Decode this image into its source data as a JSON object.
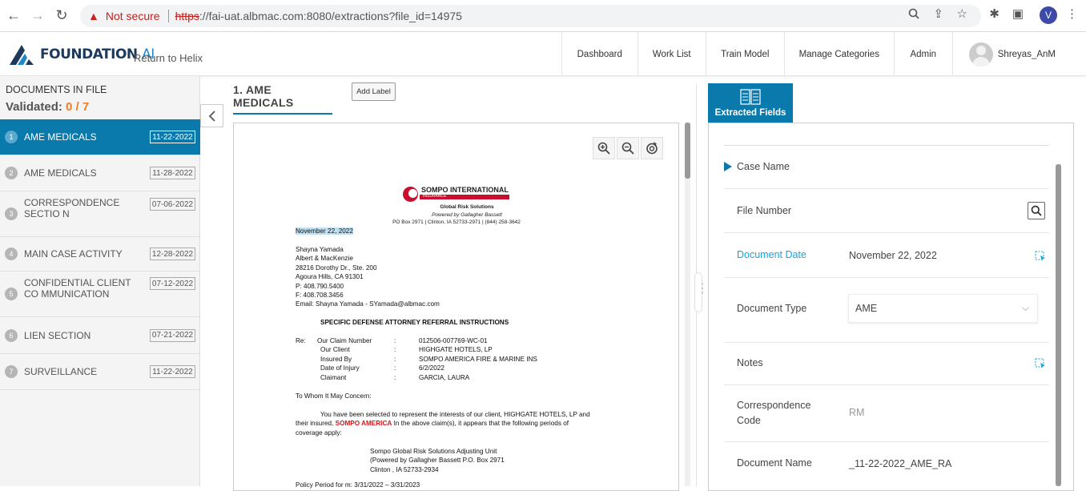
{
  "browser": {
    "not_secure": "Not secure",
    "url_scheme": "https",
    "url_rest": "://fai-uat.albmac.com:8080/extractions?file_id=14975",
    "profile_initial": "V"
  },
  "header": {
    "logo_main": "FOUNDATION",
    "logo_ai": "AI",
    "return_link": "Return to Helix",
    "nav": [
      "Dashboard",
      "Work List",
      "Train Model",
      "Manage Categories",
      "Admin"
    ],
    "user_name": "Shreyas_AnM"
  },
  "left": {
    "title": "DOCUMENTS IN FILE",
    "validated_label": "Validated:",
    "validated_count": "0 / 7",
    "documents": [
      {
        "num": "1",
        "name": "AME MEDICALS",
        "date": "11-22-2022"
      },
      {
        "num": "2",
        "name": "AME MEDICALS",
        "date": "11-28-2022"
      },
      {
        "num": "3",
        "name": "CORRESPONDENCE SECTIO N",
        "date": "07-06-2022"
      },
      {
        "num": "4",
        "name": "MAIN CASE ACTIVITY",
        "date": "12-28-2022"
      },
      {
        "num": "5",
        "name": "CONFIDENTIAL CLIENT CO MMUNICATION",
        "date": "07-12-2022"
      },
      {
        "num": "6",
        "name": "LIEN SECTION",
        "date": "07-21-2022"
      },
      {
        "num": "7",
        "name": "SURVEILLANCE",
        "date": "11-22-2022"
      }
    ]
  },
  "viewer": {
    "heading": "1.  AME MEDICALS",
    "add_label": "Add Label",
    "letter": {
      "company": "SOMPO INTERNATIONAL",
      "insurance_tag": "INSURANCE",
      "sub1": "Global Risk Solutions",
      "sub2": "Powered by Gallagher Bassett",
      "address": "PO Box 2971 | Clinton, IA 52733-2971 | (844) 258-3642",
      "date": "November 22, 2022",
      "recipient": [
        "Shayna Yamada",
        "Albert & MacKenzie",
        "28216 Dorothy Dr., Ste. 200",
        "Agoura Hills, CA 91301",
        "P: 408.790.5400",
        "F: 408.708.3456",
        "Email: Shayna Yamada  - SYamada@albmac.com"
      ],
      "subject": "SPECIFIC DEFENSE ATTORNEY REFERRAL INSTRUCTIONS",
      "re_label": "Re:",
      "re_rows": [
        {
          "k": "Our Claim Number",
          "v": "012506-007769-WC-01"
        },
        {
          "k": "Our Client",
          "v": "HIGHGATE HOTELS, LP"
        },
        {
          "k": "Insured By",
          "v": "SOMPO AMERICA FIRE & MARINE INS"
        },
        {
          "k": "Date of Injury",
          "v": "6/2/2022"
        },
        {
          "k": "Claimant",
          "v": "GARCIA, LAURA"
        }
      ],
      "colon": ":",
      "greeting": "To Whom It May Concern:",
      "para1a": "You have been selected to represent the interests of our client, HIGHGATE HOTELS, LP and",
      "para1b_pre": "their insured,",
      "para1b_red": "SOMPO AMERICA",
      "para1b_post": "In the above claim(s), it appears that the following periods of",
      "para1c": "coverage apply:",
      "unit": [
        "Sompo Global Risk Solutions Adjusting Unit",
        "(Powered by Gallagher Bassett P.O. Box 2971",
        "Clinton , IA 52733-2934"
      ],
      "cutoff": "Policy Period for m: 3/31/2022 – 3/31/2023"
    }
  },
  "right": {
    "tab_label": "Extracted Fields",
    "fields": {
      "case_name": "Case Name",
      "file_number": "File Number",
      "document_date_label": "Document Date",
      "document_date_value": "November 22, 2022",
      "document_type_label": "Document Type",
      "document_type_value": "AME",
      "notes_label": "Notes",
      "correspondence_label_1": "Correspondence",
      "correspondence_label_2": "Code",
      "correspondence_value": "RM",
      "document_name_label": "Document Name",
      "document_name_value": "_11-22-2022_AME_RA"
    }
  },
  "colors": {
    "primary": "#0a7aad",
    "accent_orange": "#f07d28",
    "link": "#1aa3d9",
    "brand_red": "#c8102e"
  }
}
